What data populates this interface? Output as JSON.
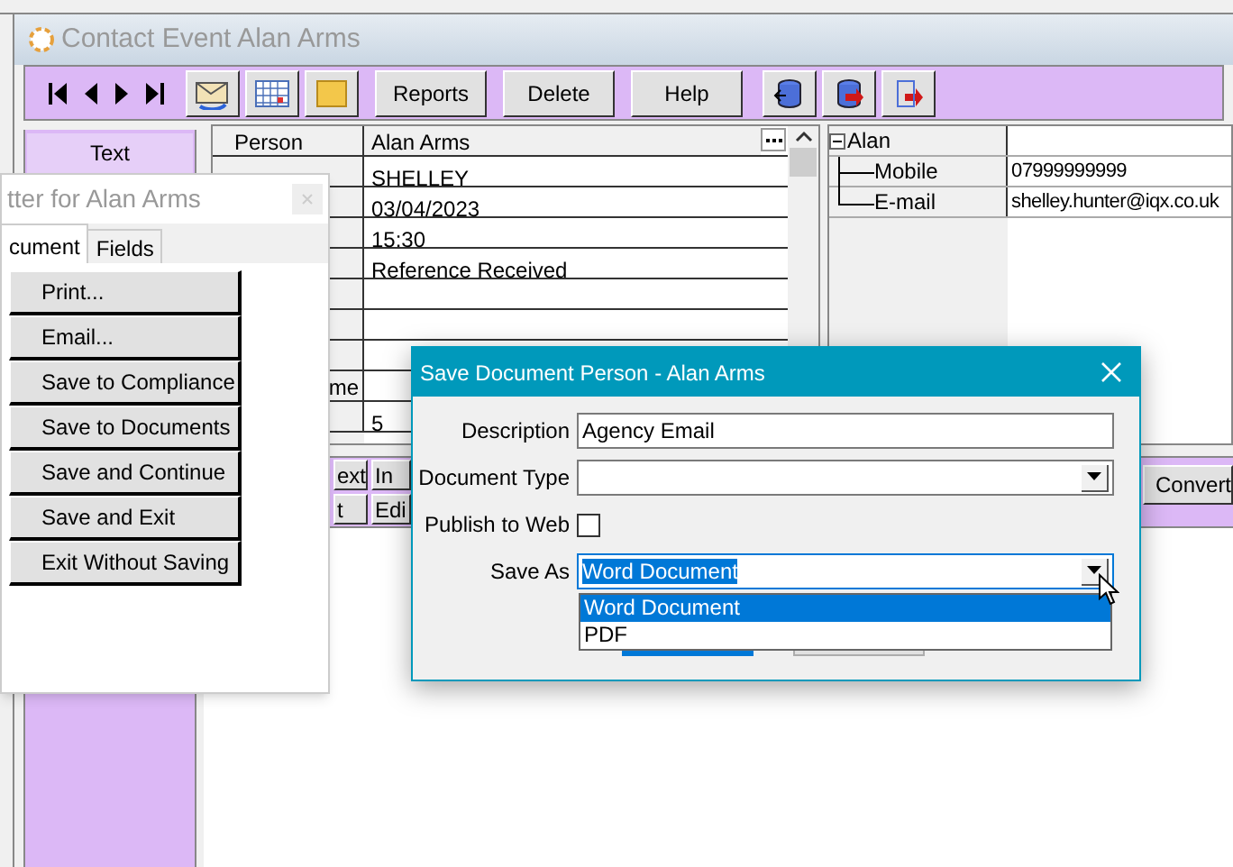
{
  "main_window": {
    "title": "Contact Event Alan Arms",
    "toolbar_buttons": [
      {
        "label": "Reports"
      },
      {
        "label": "Delete"
      },
      {
        "label": "Help"
      }
    ],
    "side_button": "Text",
    "grid": {
      "header": {
        "label": "Person",
        "value": "Alan Arms"
      },
      "rows": [
        {
          "value": "SHELLEY"
        },
        {
          "value": "03/04/2023"
        },
        {
          "value": "15:30"
        },
        {
          "value": "Reference Received"
        },
        {
          "value": ""
        },
        {
          "value": ""
        },
        {
          "value": ""
        },
        {
          "label": "me",
          "value": ""
        },
        {
          "value": "5"
        }
      ]
    },
    "tree": [
      {
        "label": "Alan",
        "expanded": true,
        "children": [
          {
            "label": "Mobile",
            "value": "07999999999"
          },
          {
            "label": "E-mail",
            "value": "shelley.hunter@iqx.co.uk"
          }
        ]
      }
    ],
    "bottom_buttons": [
      {
        "label": "ext"
      },
      {
        "label": "In"
      },
      {
        "label": "Convert"
      },
      {
        "label": "t"
      },
      {
        "label": "Edi"
      }
    ]
  },
  "letter_window": {
    "title": "tter for Alan Arms",
    "tabs": [
      {
        "label": "cument",
        "selected": true
      },
      {
        "label": "Fields",
        "selected": false
      }
    ],
    "buttons": [
      "Print...",
      "Email...",
      "Save to Compliance",
      "Save to Documents",
      "Save and Continue",
      "Save and Exit",
      "Exit Without Saving"
    ]
  },
  "dialog": {
    "title": "Save Document Person - Alan Arms",
    "fields": [
      {
        "kind": "text",
        "label": "Description",
        "value": "Agency Email"
      },
      {
        "kind": "select",
        "label": "Document Type"
      },
      {
        "kind": "checkbox",
        "label": "Publish to Web",
        "checked": false
      },
      {
        "kind": "select",
        "label": "Save As",
        "value": "Word Document",
        "open": true,
        "options": [
          {
            "label": "Word Document",
            "selected": true
          },
          {
            "label": "PDF",
            "selected": false
          }
        ]
      }
    ]
  }
}
